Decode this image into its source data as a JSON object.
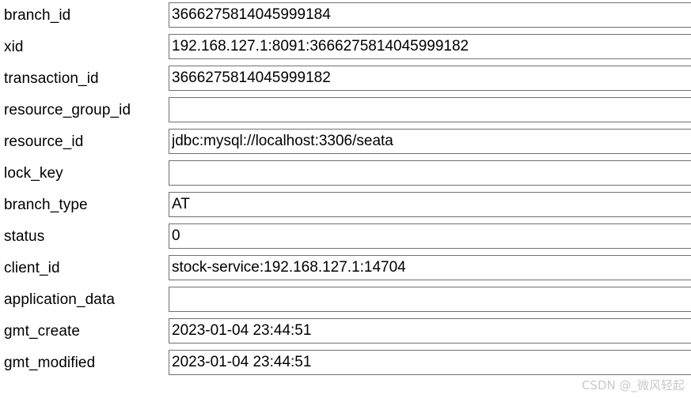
{
  "form": {
    "fields": [
      {
        "label": "branch_id",
        "value": "3666275814045999184",
        "placeholder": ""
      },
      {
        "label": "xid",
        "value": "192.168.127.1:8091:3666275814045999182",
        "placeholder": ""
      },
      {
        "label": "transaction_id",
        "value": "3666275814045999182",
        "placeholder": ""
      },
      {
        "label": "resource_group_id",
        "value": "",
        "placeholder": ""
      },
      {
        "label": "resource_id",
        "value": "jdbc:mysql://localhost:3306/seata",
        "placeholder": ""
      },
      {
        "label": "lock_key",
        "value": "",
        "placeholder": ""
      },
      {
        "label": "branch_type",
        "value": "AT",
        "placeholder": ""
      },
      {
        "label": "status",
        "value": "0",
        "placeholder": ""
      },
      {
        "label": "client_id",
        "value": "stock-service:192.168.127.1:14704",
        "placeholder": ""
      },
      {
        "label": "application_data",
        "value": "",
        "placeholder": ""
      },
      {
        "label": "gmt_create",
        "value": "2023-01-04 23:44:51",
        "placeholder": ""
      },
      {
        "label": "gmt_modified",
        "value": "2023-01-04 23:44:51",
        "placeholder": ""
      }
    ]
  },
  "watermark": {
    "text": "CSDN @_微风轻起"
  }
}
